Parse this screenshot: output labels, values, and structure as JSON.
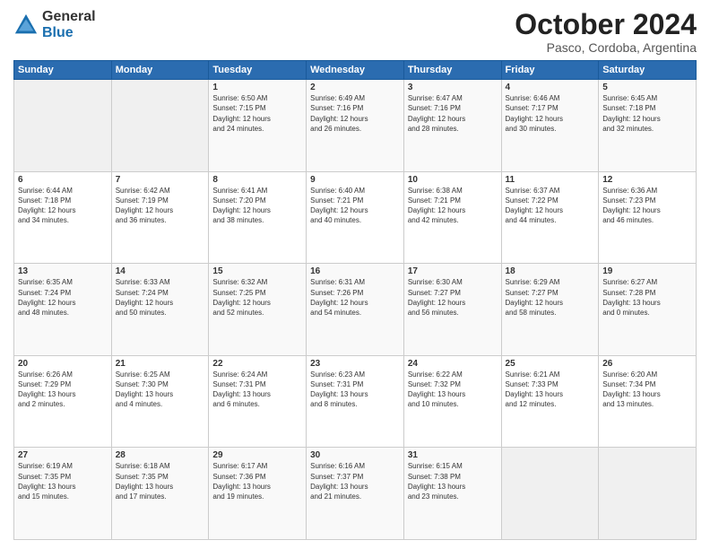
{
  "logo": {
    "general": "General",
    "blue": "Blue"
  },
  "header": {
    "month": "October 2024",
    "location": "Pasco, Cordoba, Argentina"
  },
  "weekdays": [
    "Sunday",
    "Monday",
    "Tuesday",
    "Wednesday",
    "Thursday",
    "Friday",
    "Saturday"
  ],
  "weeks": [
    [
      {
        "day": "",
        "info": ""
      },
      {
        "day": "",
        "info": ""
      },
      {
        "day": "1",
        "info": "Sunrise: 6:50 AM\nSunset: 7:15 PM\nDaylight: 12 hours\nand 24 minutes."
      },
      {
        "day": "2",
        "info": "Sunrise: 6:49 AM\nSunset: 7:16 PM\nDaylight: 12 hours\nand 26 minutes."
      },
      {
        "day": "3",
        "info": "Sunrise: 6:47 AM\nSunset: 7:16 PM\nDaylight: 12 hours\nand 28 minutes."
      },
      {
        "day": "4",
        "info": "Sunrise: 6:46 AM\nSunset: 7:17 PM\nDaylight: 12 hours\nand 30 minutes."
      },
      {
        "day": "5",
        "info": "Sunrise: 6:45 AM\nSunset: 7:18 PM\nDaylight: 12 hours\nand 32 minutes."
      }
    ],
    [
      {
        "day": "6",
        "info": "Sunrise: 6:44 AM\nSunset: 7:18 PM\nDaylight: 12 hours\nand 34 minutes."
      },
      {
        "day": "7",
        "info": "Sunrise: 6:42 AM\nSunset: 7:19 PM\nDaylight: 12 hours\nand 36 minutes."
      },
      {
        "day": "8",
        "info": "Sunrise: 6:41 AM\nSunset: 7:20 PM\nDaylight: 12 hours\nand 38 minutes."
      },
      {
        "day": "9",
        "info": "Sunrise: 6:40 AM\nSunset: 7:21 PM\nDaylight: 12 hours\nand 40 minutes."
      },
      {
        "day": "10",
        "info": "Sunrise: 6:38 AM\nSunset: 7:21 PM\nDaylight: 12 hours\nand 42 minutes."
      },
      {
        "day": "11",
        "info": "Sunrise: 6:37 AM\nSunset: 7:22 PM\nDaylight: 12 hours\nand 44 minutes."
      },
      {
        "day": "12",
        "info": "Sunrise: 6:36 AM\nSunset: 7:23 PM\nDaylight: 12 hours\nand 46 minutes."
      }
    ],
    [
      {
        "day": "13",
        "info": "Sunrise: 6:35 AM\nSunset: 7:24 PM\nDaylight: 12 hours\nand 48 minutes."
      },
      {
        "day": "14",
        "info": "Sunrise: 6:33 AM\nSunset: 7:24 PM\nDaylight: 12 hours\nand 50 minutes."
      },
      {
        "day": "15",
        "info": "Sunrise: 6:32 AM\nSunset: 7:25 PM\nDaylight: 12 hours\nand 52 minutes."
      },
      {
        "day": "16",
        "info": "Sunrise: 6:31 AM\nSunset: 7:26 PM\nDaylight: 12 hours\nand 54 minutes."
      },
      {
        "day": "17",
        "info": "Sunrise: 6:30 AM\nSunset: 7:27 PM\nDaylight: 12 hours\nand 56 minutes."
      },
      {
        "day": "18",
        "info": "Sunrise: 6:29 AM\nSunset: 7:27 PM\nDaylight: 12 hours\nand 58 minutes."
      },
      {
        "day": "19",
        "info": "Sunrise: 6:27 AM\nSunset: 7:28 PM\nDaylight: 13 hours\nand 0 minutes."
      }
    ],
    [
      {
        "day": "20",
        "info": "Sunrise: 6:26 AM\nSunset: 7:29 PM\nDaylight: 13 hours\nand 2 minutes."
      },
      {
        "day": "21",
        "info": "Sunrise: 6:25 AM\nSunset: 7:30 PM\nDaylight: 13 hours\nand 4 minutes."
      },
      {
        "day": "22",
        "info": "Sunrise: 6:24 AM\nSunset: 7:31 PM\nDaylight: 13 hours\nand 6 minutes."
      },
      {
        "day": "23",
        "info": "Sunrise: 6:23 AM\nSunset: 7:31 PM\nDaylight: 13 hours\nand 8 minutes."
      },
      {
        "day": "24",
        "info": "Sunrise: 6:22 AM\nSunset: 7:32 PM\nDaylight: 13 hours\nand 10 minutes."
      },
      {
        "day": "25",
        "info": "Sunrise: 6:21 AM\nSunset: 7:33 PM\nDaylight: 13 hours\nand 12 minutes."
      },
      {
        "day": "26",
        "info": "Sunrise: 6:20 AM\nSunset: 7:34 PM\nDaylight: 13 hours\nand 13 minutes."
      }
    ],
    [
      {
        "day": "27",
        "info": "Sunrise: 6:19 AM\nSunset: 7:35 PM\nDaylight: 13 hours\nand 15 minutes."
      },
      {
        "day": "28",
        "info": "Sunrise: 6:18 AM\nSunset: 7:35 PM\nDaylight: 13 hours\nand 17 minutes."
      },
      {
        "day": "29",
        "info": "Sunrise: 6:17 AM\nSunset: 7:36 PM\nDaylight: 13 hours\nand 19 minutes."
      },
      {
        "day": "30",
        "info": "Sunrise: 6:16 AM\nSunset: 7:37 PM\nDaylight: 13 hours\nand 21 minutes."
      },
      {
        "day": "31",
        "info": "Sunrise: 6:15 AM\nSunset: 7:38 PM\nDaylight: 13 hours\nand 23 minutes."
      },
      {
        "day": "",
        "info": ""
      },
      {
        "day": "",
        "info": ""
      }
    ]
  ]
}
